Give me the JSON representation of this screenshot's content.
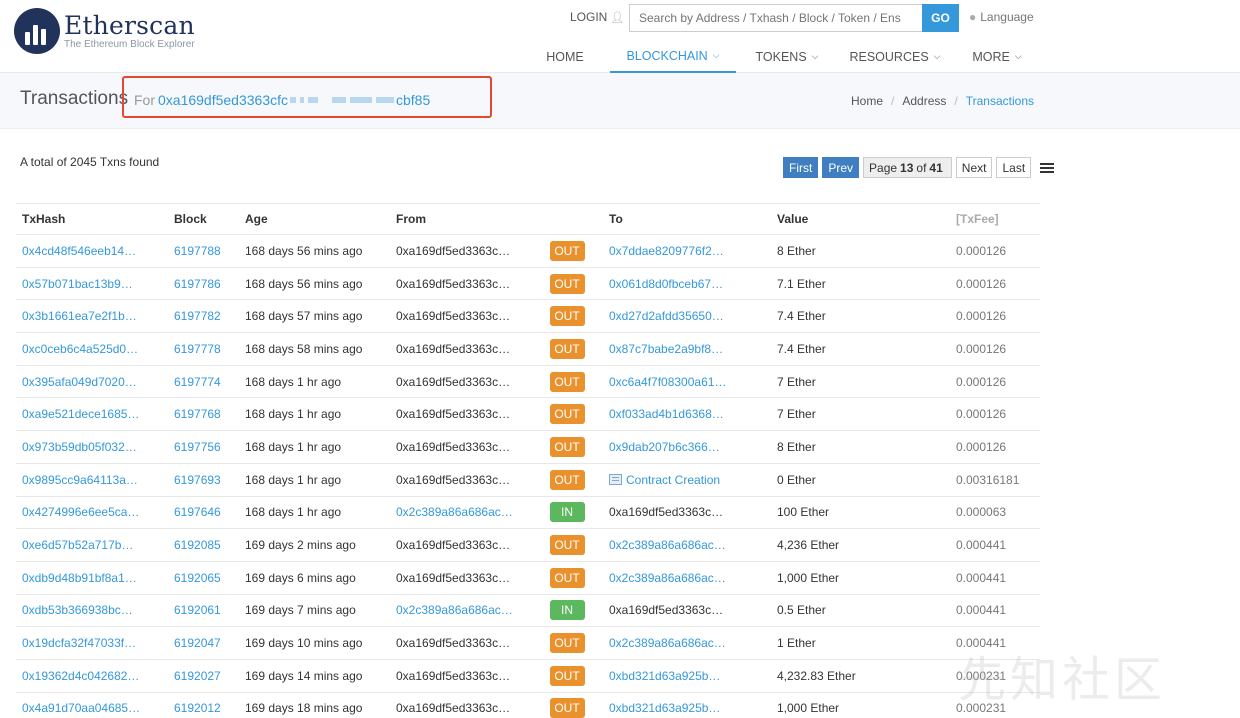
{
  "header": {
    "brand": "Etherscan",
    "tagline": "The Ethereum Block Explorer",
    "login_label": "LOGIN",
    "search_placeholder": "Search by Address / Txhash / Block / Token / Ens",
    "go_label": "GO",
    "language_label": "Language",
    "nav": [
      {
        "label": "HOME",
        "active": false
      },
      {
        "label": "BLOCKCHAIN",
        "active": true
      },
      {
        "label": "TOKENS",
        "active": false
      },
      {
        "label": "RESOURCES",
        "active": false
      },
      {
        "label": "MORE",
        "active": false
      }
    ]
  },
  "subheader": {
    "title": "Transactions",
    "for_label": "For",
    "address_start": "0xa169df5ed3363cfc",
    "address_end": "cbf85",
    "breadcrumbs": [
      "Home",
      "Address",
      "Transactions"
    ]
  },
  "summary": {
    "total_text": "A total of 2045 Txns found"
  },
  "pager": {
    "first": "First",
    "prev": "Prev",
    "page_word": "Page",
    "current": "13",
    "of_word": "of",
    "total": "41",
    "next": "Next",
    "last": "Last"
  },
  "table": {
    "columns": [
      "TxHash",
      "Block",
      "Age",
      "From",
      "To",
      "Value",
      "[TxFee]"
    ],
    "rows": [
      {
        "hash": "0x4cd48f546eeb14…",
        "block": "6197788",
        "age": "168 days 56 mins ago",
        "from": "0xa169df5ed3363c…",
        "dir": "OUT",
        "to": "0x7ddae8209776f2…",
        "value": "8 Ether",
        "fee": "0.000126"
      },
      {
        "hash": "0x57b071bac13b9…",
        "block": "6197786",
        "age": "168 days 56 mins ago",
        "from": "0xa169df5ed3363c…",
        "dir": "OUT",
        "to": "0x061d8d0fbceb67…",
        "value": "7.1 Ether",
        "fee": "0.000126"
      },
      {
        "hash": "0x3b1661ea7e2f1b…",
        "block": "6197782",
        "age": "168 days 57 mins ago",
        "from": "0xa169df5ed3363c…",
        "dir": "OUT",
        "to": "0xd27d2afdd35650…",
        "value": "7.4 Ether",
        "fee": "0.000126"
      },
      {
        "hash": "0xc0ceb6c4a525d0…",
        "block": "6197778",
        "age": "168 days 58 mins ago",
        "from": "0xa169df5ed3363c…",
        "dir": "OUT",
        "to": "0x87c7babe2a9bf8…",
        "value": "7.4 Ether",
        "fee": "0.000126"
      },
      {
        "hash": "0x395afa049d7020…",
        "block": "6197774",
        "age": "168 days 1 hr ago",
        "from": "0xa169df5ed3363c…",
        "dir": "OUT",
        "to": "0xc6a4f7f08300a61…",
        "value": "7 Ether",
        "fee": "0.000126"
      },
      {
        "hash": "0xa9e521dece1685…",
        "block": "6197768",
        "age": "168 days 1 hr ago",
        "from": "0xa169df5ed3363c…",
        "dir": "OUT",
        "to": "0xf033ad4b1d6368…",
        "value": "7 Ether",
        "fee": "0.000126"
      },
      {
        "hash": "0x973b59db05f032…",
        "block": "6197756",
        "age": "168 days 1 hr ago",
        "from": "0xa169df5ed3363c…",
        "dir": "OUT",
        "to": "0x9dab207b6c366…",
        "value": "8 Ether",
        "fee": "0.000126"
      },
      {
        "hash": "0x9895cc9a64113a…",
        "block": "6197693",
        "age": "168 days 1 hr ago",
        "from": "0xa169df5ed3363c…",
        "dir": "OUT",
        "to": "Contract Creation",
        "value": "0 Ether",
        "fee": "0.00316181"
      },
      {
        "hash": "0x4274996e6ee5ca…",
        "block": "6197646",
        "age": "168 days 1 hr ago",
        "from": "0x2c389a86a686ac…",
        "dir": "IN",
        "to": "0xa169df5ed3363c…",
        "value": "100 Ether",
        "fee": "0.000063"
      },
      {
        "hash": "0xe6d57b52a717b…",
        "block": "6192085",
        "age": "169 days 2 mins ago",
        "from": "0xa169df5ed3363c…",
        "dir": "OUT",
        "to": "0x2c389a86a686ac…",
        "value": "4,236 Ether",
        "fee": "0.000441"
      },
      {
        "hash": "0xdb9d48b91bf8a1…",
        "block": "6192065",
        "age": "169 days 6 mins ago",
        "from": "0xa169df5ed3363c…",
        "dir": "OUT",
        "to": "0x2c389a86a686ac…",
        "value": "1,000 Ether",
        "fee": "0.000441"
      },
      {
        "hash": "0xdb53b366938bc…",
        "block": "6192061",
        "age": "169 days 7 mins ago",
        "from": "0x2c389a86a686ac…",
        "dir": "IN",
        "to": "0xa169df5ed3363c…",
        "value": "0.5 Ether",
        "fee": "0.000441"
      },
      {
        "hash": "0x19dcfa32f47033f…",
        "block": "6192047",
        "age": "169 days 10 mins ago",
        "from": "0xa169df5ed3363c…",
        "dir": "OUT",
        "to": "0x2c389a86a686ac…",
        "value": "1 Ether",
        "fee": "0.000441"
      },
      {
        "hash": "0x19362d4c042682…",
        "block": "6192027",
        "age": "169 days 14 mins ago",
        "from": "0xa169df5ed3363c…",
        "dir": "OUT",
        "to": "0xbd321d63a925b…",
        "value": "4,232.83 Ether",
        "fee": "0.000231"
      },
      {
        "hash": "0x4a91d70aa04685…",
        "block": "6192012",
        "age": "169 days 18 mins ago",
        "from": "0xa169df5ed3363c…",
        "dir": "OUT",
        "to": "0xbd321d63a925b…",
        "value": "1,000 Ether",
        "fee": "0.000231"
      }
    ]
  },
  "watermark": "先知社区",
  "colors": {
    "accent": "#3498db",
    "out_badge": "#e8912d",
    "in_badge": "#5cb85c",
    "highlight_box": "#e24a2f",
    "pager_active": "#3f7fc1"
  }
}
